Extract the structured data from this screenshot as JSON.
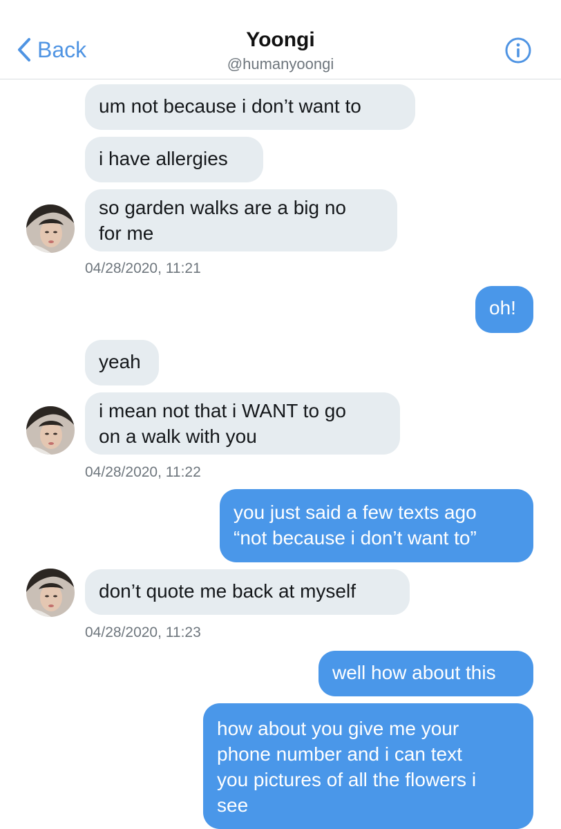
{
  "header": {
    "back_label": "Back",
    "title": "Yoongi",
    "handle": "@humanyoongi"
  },
  "colors": {
    "accent": "#4f94e3",
    "incoming_bubble": "#e6ecf0",
    "outgoing_bubble": "#4a97e9",
    "timestamp": "#6e767d"
  },
  "icons": {
    "back": "chevron-left-icon",
    "info": "info-circle-icon",
    "avatar": "profile-photo"
  },
  "messages": [
    {
      "dir": "in",
      "text": "um not because i don’t want to"
    },
    {
      "dir": "in",
      "text": "i have allergies"
    },
    {
      "dir": "in",
      "lines": [
        "so garden walks are a big no",
        "for me"
      ]
    },
    {
      "timestamp": "04/28/2020, 11:21"
    },
    {
      "dir": "out",
      "text": "oh!"
    },
    {
      "dir": "in",
      "text": "yeah"
    },
    {
      "dir": "in",
      "lines": [
        "i mean not that i WANT to go",
        "on a walk with you"
      ]
    },
    {
      "timestamp": "04/28/2020, 11:22"
    },
    {
      "dir": "out",
      "lines": [
        "you just said a few texts ago",
        "“not because i don’t want to”"
      ]
    },
    {
      "dir": "in",
      "text": "don’t quote me back at myself"
    },
    {
      "timestamp": "04/28/2020, 11:23"
    },
    {
      "dir": "out",
      "text": "well how about this"
    },
    {
      "dir": "out",
      "lines": [
        "how about you give me your",
        "phone number and i can text",
        "you pictures of all the flowers i",
        "see"
      ]
    }
  ]
}
